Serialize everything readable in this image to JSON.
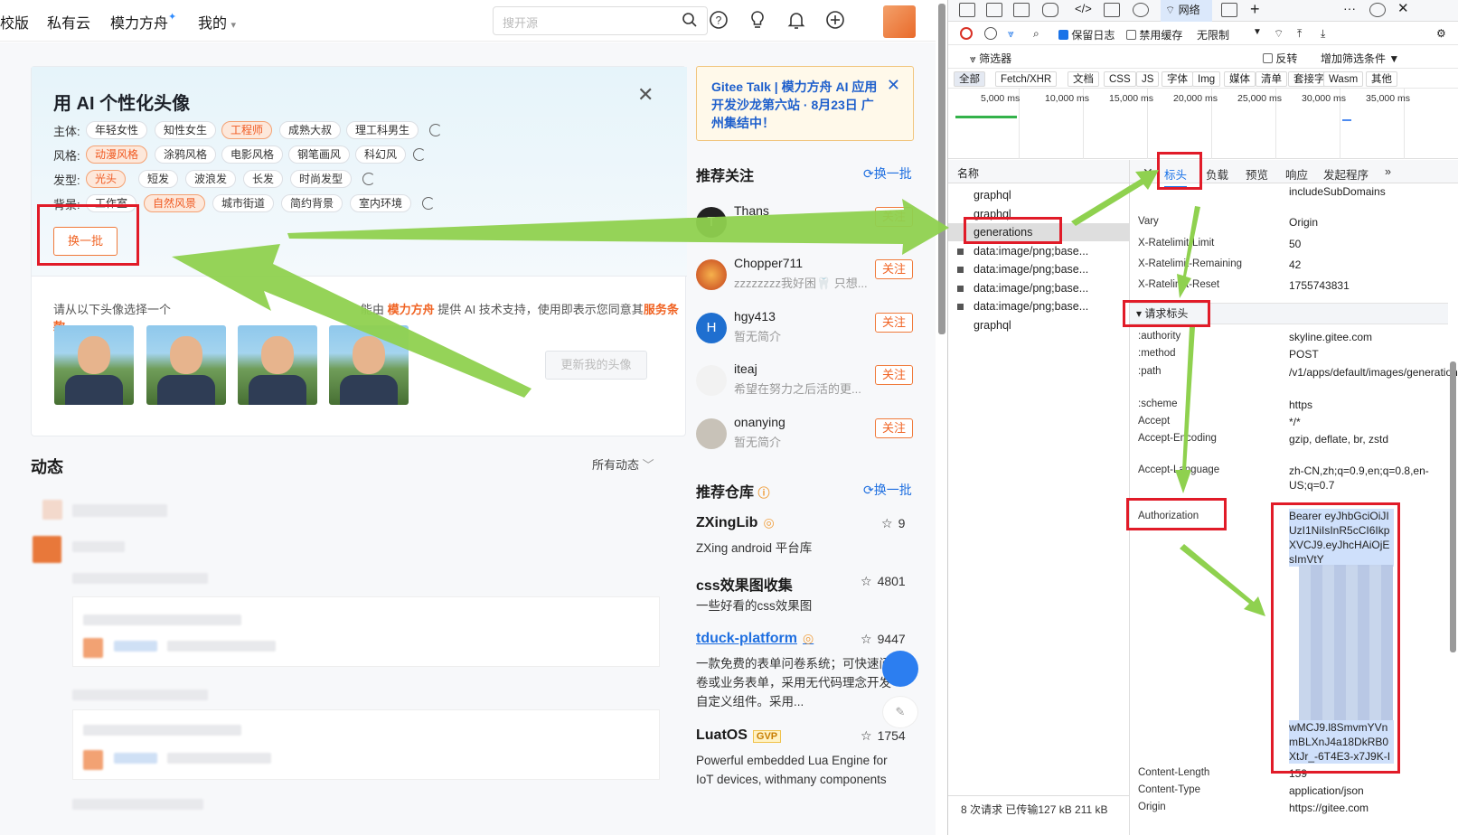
{
  "nav": {
    "items": [
      "校版",
      "私有云",
      "模力方舟",
      "我的"
    ],
    "star": "✦",
    "dropdown": "▾",
    "search_placeholder": "搜开源"
  },
  "ai_card": {
    "title": "用 AI 个性化头像",
    "rows": [
      {
        "label": "主体:",
        "chips": [
          "年轻女性",
          "知性女生",
          "工程师",
          "成熟大叔",
          "理工科男生"
        ],
        "active": "工程师"
      },
      {
        "label": "风格:",
        "chips": [
          "动漫风格",
          "涂鸦风格",
          "电影风格",
          "钢笔画风",
          "科幻风"
        ],
        "active": "动漫风格"
      },
      {
        "label": "发型:",
        "chips": [
          "光头",
          "短发",
          "波浪发",
          "长发",
          "时尚发型"
        ],
        "active": "光头"
      },
      {
        "label": "背景:",
        "chips": [
          "工作室",
          "自然风景",
          "城市街道",
          "简约背景",
          "室内环境"
        ],
        "active": "自然风景"
      }
    ],
    "swap_button": "换一批",
    "desc_prefix": "请从以下头像选择一个",
    "desc_mid": "能由",
    "desc_brand": "模力方舟",
    "desc_text": "提供 AI 技术支持，使用即表示您同意其",
    "desc_terms": "服务条款",
    "update_button": "更新我的头像"
  },
  "feed": {
    "title": "动态",
    "filter": "所有动态"
  },
  "banner": {
    "text": "Gitee Talk | 模力方舟 AI 应用开发沙龙第六站 · 8月23日 广州集结中！"
  },
  "follow": {
    "title": "推荐关注",
    "refresh": "换一批",
    "follow_label": "关注",
    "items": [
      {
        "name": "Thans",
        "desc": "",
        "initial": "T"
      },
      {
        "name": "Chopper711",
        "desc": "zzzzzzzz我好困🦷 只想..."
      },
      {
        "name": "hgy413",
        "desc": "暂无简介",
        "initial": "H"
      },
      {
        "name": "iteaj",
        "desc": "希望在努力之后活的更..."
      },
      {
        "name": "onanying",
        "desc": "暂无简介"
      }
    ]
  },
  "repos": {
    "title": "推荐仓库",
    "refresh": "换一批",
    "items": [
      {
        "name": "ZXingLib",
        "stars": "9",
        "desc": "ZXing android 平台库"
      },
      {
        "name": "css效果图收集",
        "stars": "4801",
        "desc": "一些好看的css效果图"
      },
      {
        "name": "tduck-platform",
        "stars": "9447",
        "desc": "一款免费的表单问卷系统；可快速问卷或业务表单，采用无代码理念开发自定义组件。采用..."
      },
      {
        "name": "LuatOS",
        "badge": "GVP",
        "stars": "1754",
        "desc": "Powerful embedded Lua Engine for IoT devices, withmany components"
      }
    ]
  },
  "devtools": {
    "network_tab": "网络",
    "preserve_log": "保留日志",
    "disable_cache": "禁用缓存",
    "throttle": "无限制",
    "filter_label": "筛选器",
    "invert": "反转",
    "more_filters": "增加筛选条件",
    "type_filters": [
      "全部",
      "Fetch/XHR",
      "文档",
      "CSS",
      "JS",
      "字体",
      "Img",
      "媒体",
      "清单",
      "套接字",
      "Wasm",
      "其他"
    ],
    "timeline_labels": [
      "5,000 ms",
      "10,000 ms",
      "15,000 ms",
      "20,000 ms",
      "25,000 ms",
      "30,000 ms",
      "35,000 ms"
    ],
    "list_header": "名称",
    "requests": [
      "graphql",
      "graphql",
      "generations",
      "data:image/png;base...",
      "data:image/png;base...",
      "data:image/png;base...",
      "data:image/png;base...",
      "graphql"
    ],
    "detail_tabs": [
      "标头",
      "负载",
      "预览",
      "响应",
      "发起程序"
    ],
    "response_headers": [
      {
        "k": "",
        "v": "includeSubDomains"
      },
      {
        "k": "Vary",
        "v": "Origin"
      },
      {
        "k": "X-Ratelimit-Limit",
        "v": "50"
      },
      {
        "k": "X-Ratelimit-Remaining",
        "v": "42"
      },
      {
        "k": "X-Ratelimit-Reset",
        "v": "1755743831"
      }
    ],
    "request_section": "▾ 请求标头",
    "request_headers": [
      {
        "k": ":authority",
        "v": "skyline.gitee.com"
      },
      {
        "k": ":method",
        "v": "POST"
      },
      {
        "k": ":path",
        "v": "/v1/apps/default/images/generations"
      },
      {
        "k": ":scheme",
        "v": "https"
      },
      {
        "k": "Accept",
        "v": "*/*"
      },
      {
        "k": "Accept-Encoding",
        "v": "gzip, deflate, br, zstd"
      },
      {
        "k": "Accept-Language",
        "v": "zh-CN,zh;q=0.9,en;q=0.8,en-US;q=0.7"
      }
    ],
    "auth_key": "Authorization",
    "auth_value_top": "Bearer eyJhbGciOiJIUzI1NiIsInR5cCI6IkpXVCJ9.eyJhcHAiOjEsImVtY",
    "auth_value_bottom": "wMCJ9.l8SmvmYVnmBLXnJ4a18DkRB0XtJr_-6T4E3-x7J9K-I",
    "tail_headers": [
      {
        "k": "Content-Length",
        "v": "159"
      },
      {
        "k": "Content-Type",
        "v": "application/json"
      },
      {
        "k": "Origin",
        "v": "https://gitee.com"
      }
    ],
    "status": "8 次请求   已传输127 kB   211 kB"
  },
  "colors": {
    "accent": "#f06323",
    "annotation": "#e11b28",
    "arrow": "#8fd14f",
    "link": "#1f6fe0"
  }
}
